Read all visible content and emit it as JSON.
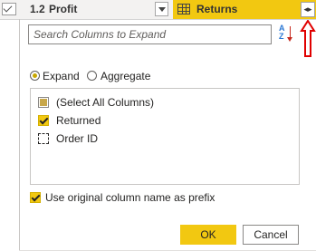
{
  "header": {
    "profit_column": {
      "type_icon": "1.2",
      "name": "Profit"
    },
    "returns_column": {
      "name": "Returns",
      "icon": "table-icon"
    },
    "expand_icon": "expand-arrows-icon"
  },
  "search": {
    "placeholder": "Search Columns to Expand",
    "value": ""
  },
  "sort": {
    "label": "AZ",
    "icon": "sort-az-icon"
  },
  "annotation": {
    "color": "#e00000"
  },
  "mode": {
    "expand_label": "Expand",
    "aggregate_label": "Aggregate",
    "selected": "Expand"
  },
  "columns_list": [
    {
      "label": "(Select All Columns)",
      "state": "indeterminate"
    },
    {
      "label": "Returned",
      "state": "checked"
    },
    {
      "label": "Order ID",
      "state": "unchecked"
    }
  ],
  "prefix_option": {
    "label": "Use original column name as prefix",
    "checked": true
  },
  "buttons": {
    "ok": "OK",
    "cancel": "Cancel"
  },
  "colors": {
    "accent": "#f2c811",
    "text": "#252423"
  }
}
